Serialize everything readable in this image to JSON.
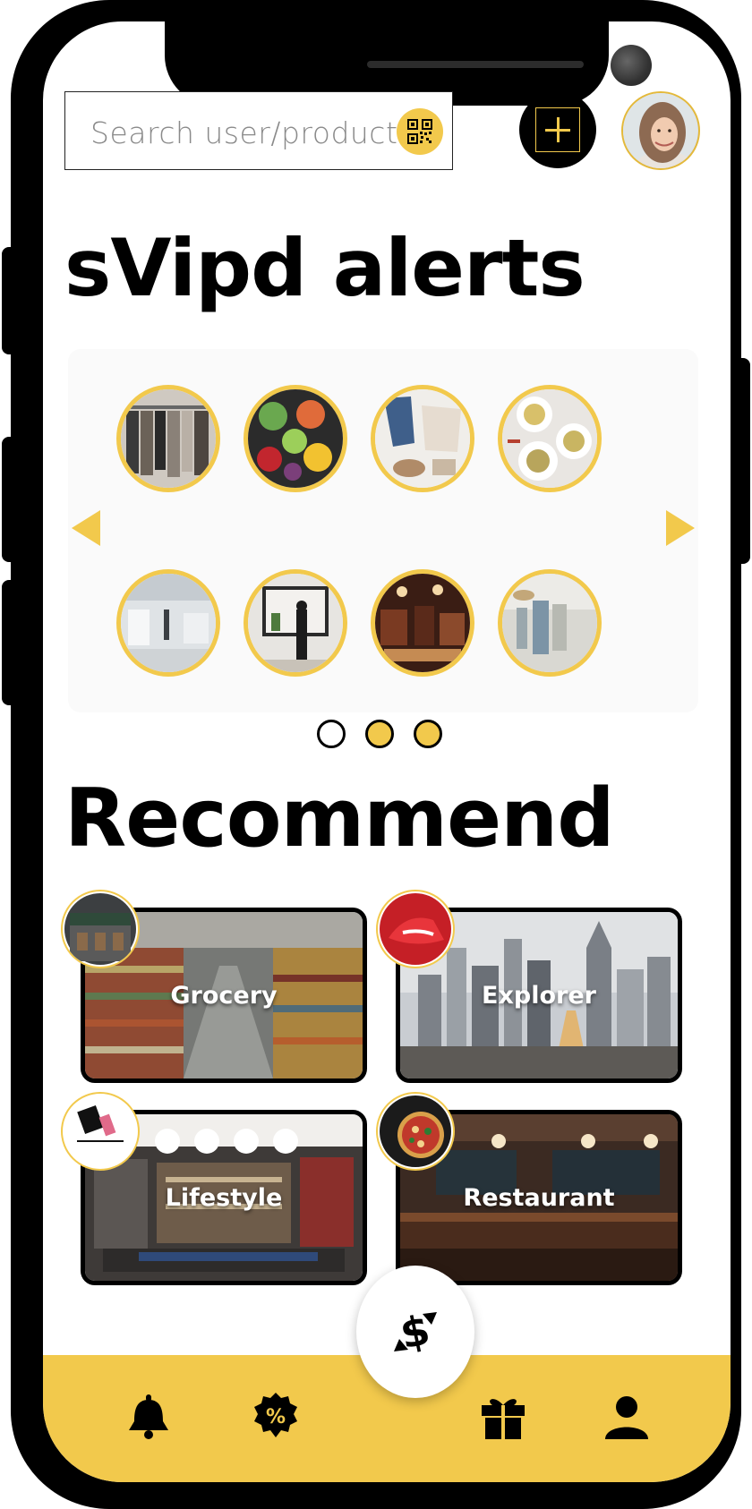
{
  "search": {
    "placeholder": "Search user/product",
    "qr_icon": "qr-code-icon"
  },
  "header": {
    "add_icon": "plus-icon",
    "avatar_icon": "user-avatar"
  },
  "alerts": {
    "title": "sVipd alerts",
    "thumbnails": [
      {
        "icon": "clothing-rack-photo"
      },
      {
        "icon": "vegetables-photo"
      },
      {
        "icon": "fashion-flatlay-photo"
      },
      {
        "icon": "salad-plates-photo"
      },
      {
        "icon": "store-interior-photo"
      },
      {
        "icon": "shop-window-photo"
      },
      {
        "icon": "antique-shop-photo"
      },
      {
        "icon": "boutique-photo"
      }
    ],
    "pagination": {
      "pages": 3,
      "active": 1
    }
  },
  "recommend": {
    "title": "Recommend",
    "cards": [
      {
        "label": "Grocery",
        "badge": "whole-foods-logo"
      },
      {
        "label": "Explorer",
        "badge": "red-sneaker-photo"
      },
      {
        "label": "Lifestyle",
        "badge": "gucci-logo"
      },
      {
        "label": "Restaurant",
        "badge": "pizza-photo"
      }
    ]
  },
  "nav": {
    "items": [
      {
        "icon": "bell-icon"
      },
      {
        "icon": "discount-badge-icon"
      },
      {
        "icon": "currency-exchange-icon"
      },
      {
        "icon": "gift-icon"
      },
      {
        "icon": "profile-icon"
      }
    ]
  },
  "colors": {
    "accent": "#f2c94c",
    "frame": "#000000",
    "background": "#ffffff"
  }
}
